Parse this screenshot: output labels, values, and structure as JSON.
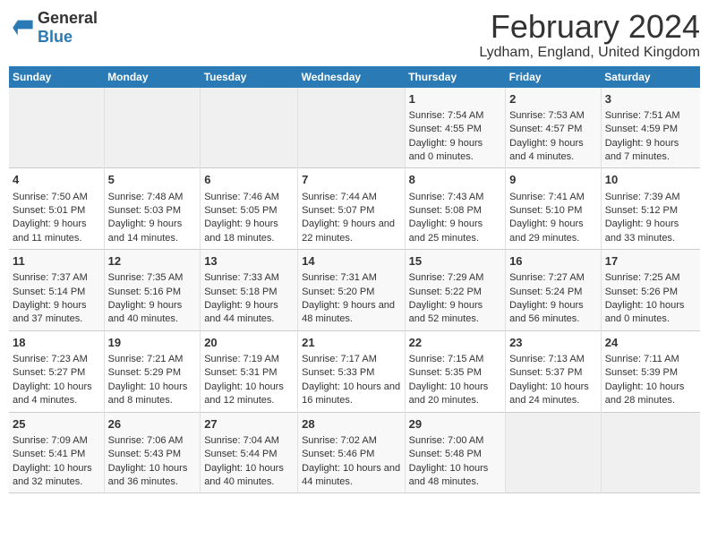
{
  "logo": {
    "text_general": "General",
    "text_blue": "Blue"
  },
  "title": "February 2024",
  "subtitle": "Lydham, England, United Kingdom",
  "days_of_week": [
    "Sunday",
    "Monday",
    "Tuesday",
    "Wednesday",
    "Thursday",
    "Friday",
    "Saturday"
  ],
  "weeks": [
    [
      {
        "day": "",
        "data": ""
      },
      {
        "day": "",
        "data": ""
      },
      {
        "day": "",
        "data": ""
      },
      {
        "day": "",
        "data": ""
      },
      {
        "day": "1",
        "data": "Sunrise: 7:54 AM\nSunset: 4:55 PM\nDaylight: 9 hours and 0 minutes."
      },
      {
        "day": "2",
        "data": "Sunrise: 7:53 AM\nSunset: 4:57 PM\nDaylight: 9 hours and 4 minutes."
      },
      {
        "day": "3",
        "data": "Sunrise: 7:51 AM\nSunset: 4:59 PM\nDaylight: 9 hours and 7 minutes."
      }
    ],
    [
      {
        "day": "4",
        "data": "Sunrise: 7:50 AM\nSunset: 5:01 PM\nDaylight: 9 hours and 11 minutes."
      },
      {
        "day": "5",
        "data": "Sunrise: 7:48 AM\nSunset: 5:03 PM\nDaylight: 9 hours and 14 minutes."
      },
      {
        "day": "6",
        "data": "Sunrise: 7:46 AM\nSunset: 5:05 PM\nDaylight: 9 hours and 18 minutes."
      },
      {
        "day": "7",
        "data": "Sunrise: 7:44 AM\nSunset: 5:07 PM\nDaylight: 9 hours and 22 minutes."
      },
      {
        "day": "8",
        "data": "Sunrise: 7:43 AM\nSunset: 5:08 PM\nDaylight: 9 hours and 25 minutes."
      },
      {
        "day": "9",
        "data": "Sunrise: 7:41 AM\nSunset: 5:10 PM\nDaylight: 9 hours and 29 minutes."
      },
      {
        "day": "10",
        "data": "Sunrise: 7:39 AM\nSunset: 5:12 PM\nDaylight: 9 hours and 33 minutes."
      }
    ],
    [
      {
        "day": "11",
        "data": "Sunrise: 7:37 AM\nSunset: 5:14 PM\nDaylight: 9 hours and 37 minutes."
      },
      {
        "day": "12",
        "data": "Sunrise: 7:35 AM\nSunset: 5:16 PM\nDaylight: 9 hours and 40 minutes."
      },
      {
        "day": "13",
        "data": "Sunrise: 7:33 AM\nSunset: 5:18 PM\nDaylight: 9 hours and 44 minutes."
      },
      {
        "day": "14",
        "data": "Sunrise: 7:31 AM\nSunset: 5:20 PM\nDaylight: 9 hours and 48 minutes."
      },
      {
        "day": "15",
        "data": "Sunrise: 7:29 AM\nSunset: 5:22 PM\nDaylight: 9 hours and 52 minutes."
      },
      {
        "day": "16",
        "data": "Sunrise: 7:27 AM\nSunset: 5:24 PM\nDaylight: 9 hours and 56 minutes."
      },
      {
        "day": "17",
        "data": "Sunrise: 7:25 AM\nSunset: 5:26 PM\nDaylight: 10 hours and 0 minutes."
      }
    ],
    [
      {
        "day": "18",
        "data": "Sunrise: 7:23 AM\nSunset: 5:27 PM\nDaylight: 10 hours and 4 minutes."
      },
      {
        "day": "19",
        "data": "Sunrise: 7:21 AM\nSunset: 5:29 PM\nDaylight: 10 hours and 8 minutes."
      },
      {
        "day": "20",
        "data": "Sunrise: 7:19 AM\nSunset: 5:31 PM\nDaylight: 10 hours and 12 minutes."
      },
      {
        "day": "21",
        "data": "Sunrise: 7:17 AM\nSunset: 5:33 PM\nDaylight: 10 hours and 16 minutes."
      },
      {
        "day": "22",
        "data": "Sunrise: 7:15 AM\nSunset: 5:35 PM\nDaylight: 10 hours and 20 minutes."
      },
      {
        "day": "23",
        "data": "Sunrise: 7:13 AM\nSunset: 5:37 PM\nDaylight: 10 hours and 24 minutes."
      },
      {
        "day": "24",
        "data": "Sunrise: 7:11 AM\nSunset: 5:39 PM\nDaylight: 10 hours and 28 minutes."
      }
    ],
    [
      {
        "day": "25",
        "data": "Sunrise: 7:09 AM\nSunset: 5:41 PM\nDaylight: 10 hours and 32 minutes."
      },
      {
        "day": "26",
        "data": "Sunrise: 7:06 AM\nSunset: 5:43 PM\nDaylight: 10 hours and 36 minutes."
      },
      {
        "day": "27",
        "data": "Sunrise: 7:04 AM\nSunset: 5:44 PM\nDaylight: 10 hours and 40 minutes."
      },
      {
        "day": "28",
        "data": "Sunrise: 7:02 AM\nSunset: 5:46 PM\nDaylight: 10 hours and 44 minutes."
      },
      {
        "day": "29",
        "data": "Sunrise: 7:00 AM\nSunset: 5:48 PM\nDaylight: 10 hours and 48 minutes."
      },
      {
        "day": "",
        "data": ""
      },
      {
        "day": "",
        "data": ""
      }
    ]
  ]
}
